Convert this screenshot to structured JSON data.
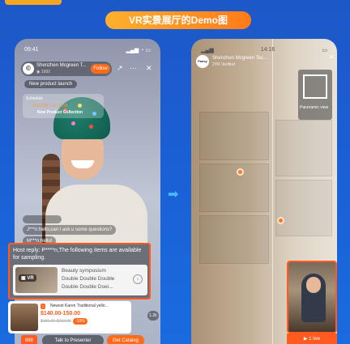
{
  "header": {
    "top_text": "",
    "banner_title": "VR实景展厅的Demo图"
  },
  "left_phone": {
    "status_time": "09:41",
    "shop": {
      "name": "Shenzhen Mcgreen T...",
      "views": "1992",
      "follow_label": "Follow"
    },
    "launch_pill": "New product launch",
    "schedule": {
      "label": "Schedule",
      "time": "10:22:08 - 10:13:59",
      "title": "New Product Collection"
    },
    "chats": [
      "J***n:hello,can I ask u some questions?",
      "M***n:hello!"
    ],
    "host_reply": {
      "text": "Host reply: P****n,The following items are available for sampling.",
      "vr_badge": "VR",
      "line1": "Beauty symposium",
      "line2": "Double Double Double",
      "line3": "Double Double Doei..."
    },
    "product": {
      "tag": "1",
      "name": "Newest Karen Traditional yello...",
      "price": "$140.00-150.00",
      "old_price": "$190.00-$210.00",
      "discount": "-10%",
      "like_count": "1.2k"
    },
    "bottom": {
      "badge": "888",
      "talk_label": "Talk to Presenter",
      "catalog_label": "Get Catalog"
    }
  },
  "right_phone": {
    "status_time": "14:16",
    "shop": {
      "name": "Shenzhen Mcgreen Tec...",
      "sub": "2YR  Verified",
      "logo_text": "Fancy"
    },
    "panorama_label": "Panoramic view",
    "video_label": "1 live"
  },
  "colors": {
    "accent": "#ff6a1a",
    "bg": "#1b5fd4",
    "arrow": "#4fb7ff"
  }
}
